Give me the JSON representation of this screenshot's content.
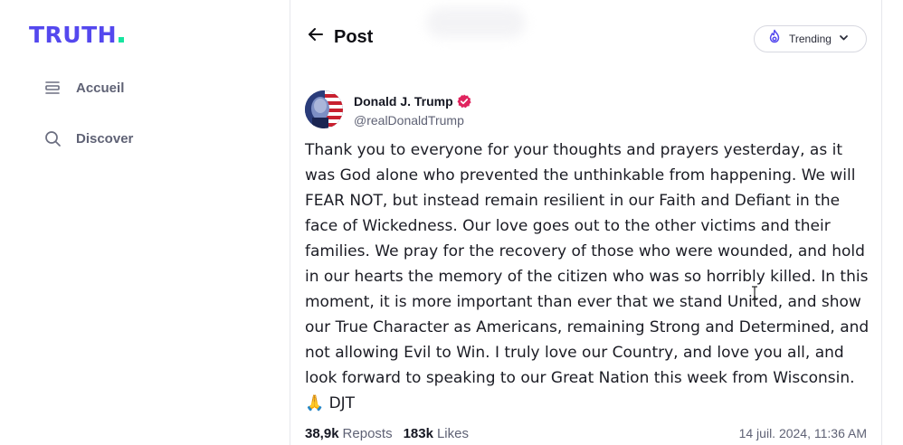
{
  "app": {
    "logo_text": "TRUTH",
    "brand_color": "#5448ee",
    "accent_color": "#17e5a0"
  },
  "sidebar": {
    "items": [
      {
        "label": "Accueil",
        "icon": "home-icon"
      },
      {
        "label": "Discover",
        "icon": "search-icon"
      }
    ]
  },
  "header": {
    "title": "Post",
    "back_icon": "arrow-left-icon",
    "feed_selector": {
      "label": "Trending",
      "icon": "flame-icon",
      "chevron": "chevron-down-icon"
    }
  },
  "post": {
    "author": {
      "name": "Donald J. Trump",
      "handle": "@realDonaldTrump",
      "verified": true,
      "verified_color": "#e0245e"
    },
    "text": "Thank you to everyone for your thoughts and prayers yesterday, as it was God alone who prevented the unthinkable from happening. We will FEAR NOT, but instead remain resilient in our Faith and Defiant in the face of Wickedness. Our love goes out to the other victims and their families. We pray for the recovery of those who were wounded, and hold in our hearts the memory of the citizen who was so horribly killed. In this moment, it is more important than ever that we stand United, and show our True Character as Americans, remaining Strong and Determined, and not allowing Evil to Win. I truly love our Country, and love you all, and look forward to speaking to our Great Nation this week from Wisconsin. 🙏 DJT",
    "stats": {
      "reposts_count": "38,9k",
      "reposts_label": "Reposts",
      "likes_count": "183k",
      "likes_label": "Likes"
    },
    "timestamp": "14 juil. 2024, 11:36 AM"
  }
}
